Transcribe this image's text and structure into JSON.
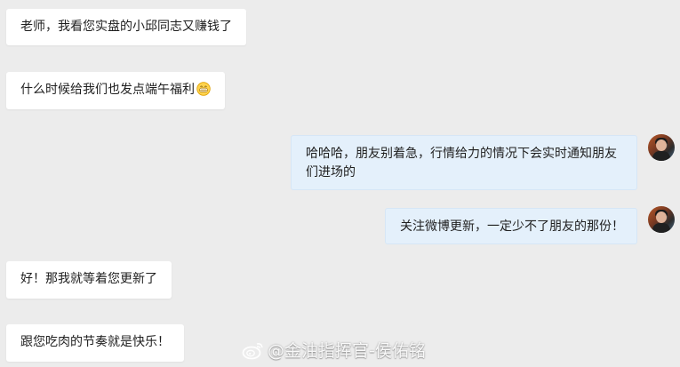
{
  "messages": [
    {
      "side": "incoming",
      "text": "老师，我看您实盘的小邱同志又赚钱了"
    },
    {
      "side": "incoming",
      "text": "什么时候给我们也发点端午福利",
      "emoji": "grinning-face-icon"
    },
    {
      "side": "outgoing",
      "text": "哈哈哈，朋友别着急，行情给力的情况下会实时通知朋友们进场的"
    },
    {
      "side": "outgoing",
      "text": "关注微博更新，一定少不了朋友的那份！"
    },
    {
      "side": "incoming",
      "text": "好！那我就等着您更新了"
    },
    {
      "side": "incoming",
      "text": "跟您吃肉的节奏就是快乐！"
    }
  ],
  "watermark": {
    "text": "@金油指挥官-侯佑铭",
    "icon": "weibo-logo-icon"
  },
  "colors": {
    "background": "#ececec",
    "incoming_bubble": "#ffffff",
    "outgoing_bubble": "#e4f0fb"
  }
}
